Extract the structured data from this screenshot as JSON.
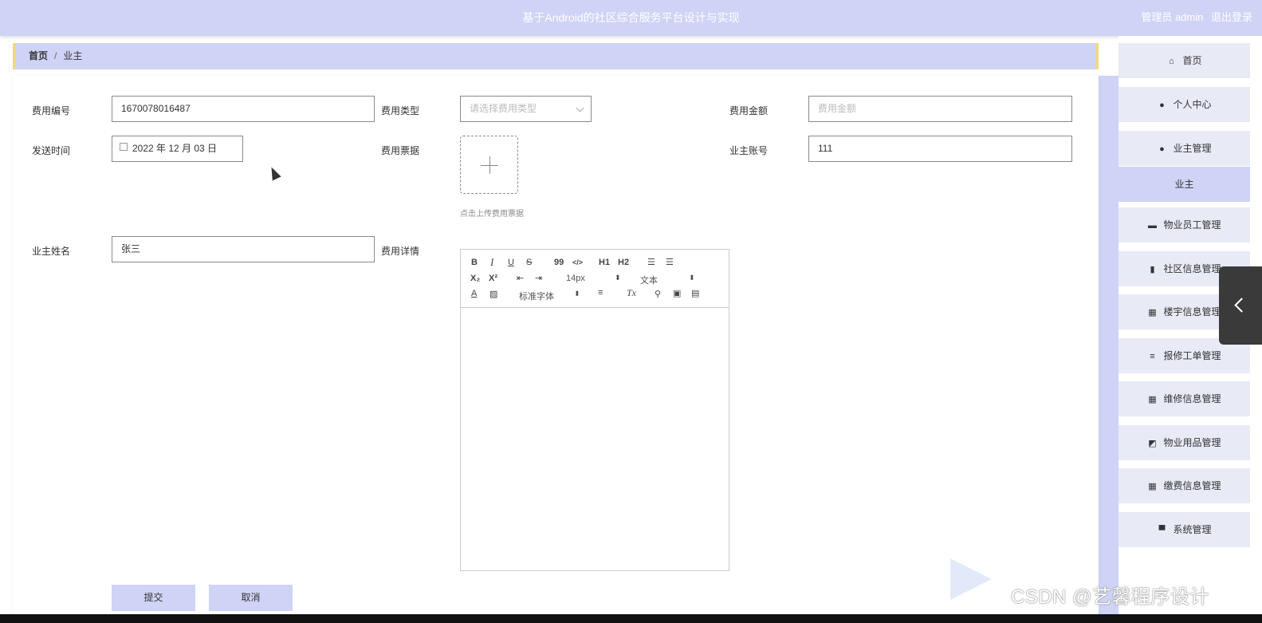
{
  "header": {
    "title": "基于Android的社区综合服务平台设计与实现",
    "user_label": "管理员 admin",
    "logout_label": "退出登录"
  },
  "breadcrumb": {
    "home": "首页",
    "separator": "/",
    "current": "业主"
  },
  "form": {
    "fee_no": {
      "label": "费用编号",
      "value": "1670078016487"
    },
    "fee_type": {
      "label": "费用类型",
      "placeholder": "请选择费用类型"
    },
    "fee_amount": {
      "label": "费用金额",
      "placeholder": "费用金额"
    },
    "send_time": {
      "label": "发送时间",
      "value": "2022 年 12 月 03 日"
    },
    "fee_receipt": {
      "label": "费用票据",
      "upload_tip": "点击上传费用票据"
    },
    "owner_account": {
      "label": "业主账号",
      "value": "111"
    },
    "owner_name": {
      "label": "业主姓名",
      "value": "张三"
    },
    "fee_detail": {
      "label": "费用详情"
    }
  },
  "editor": {
    "toolbar": {
      "bold": "B",
      "italic": "I",
      "underline": "U",
      "strike": "S",
      "quote": "99",
      "code": "</>",
      "h1": "H1",
      "h2": "H2",
      "ordered": "☰",
      "bullet": "☰",
      "sub": "X₂",
      "sup": "X²",
      "size": "14px",
      "header_select": "文本",
      "font": "标准字体",
      "clean": "Tx"
    }
  },
  "buttons": {
    "submit": "提交",
    "cancel": "取消"
  },
  "sidebar": {
    "items": [
      {
        "label": "首页",
        "icon": "home-icon",
        "glyph": "⌂"
      },
      {
        "label": "个人中心",
        "icon": "user-icon",
        "glyph": "●"
      },
      {
        "label": "业主管理",
        "icon": "pin-icon",
        "glyph": "●"
      },
      {
        "label": "业主",
        "icon": "",
        "glyph": ""
      },
      {
        "label": "物业员工管理",
        "icon": "chat-icon",
        "glyph": "▬"
      },
      {
        "label": "社区信息管理",
        "icon": "bar-chart-icon",
        "glyph": "▮"
      },
      {
        "label": "楼宇信息管理",
        "icon": "grid-icon",
        "glyph": "▦"
      },
      {
        "label": "报修工单管理",
        "icon": "list-icon",
        "glyph": "≡"
      },
      {
        "label": "维修信息管理",
        "icon": "grid-icon",
        "glyph": "▦"
      },
      {
        "label": "物业用品管理",
        "icon": "line-chart-icon",
        "glyph": "◩"
      },
      {
        "label": "缴费信息管理",
        "icon": "grid-icon",
        "glyph": "▦"
      },
      {
        "label": "系统管理",
        "icon": "monitor-icon",
        "glyph": "▀"
      }
    ]
  },
  "watermark": {
    "text": "CSDN @艺馨程序设计"
  },
  "colors": {
    "accent": "#cfd3f5",
    "breadcrumb_border": "#f0d97a",
    "menu_bg": "#e8eaf6"
  }
}
